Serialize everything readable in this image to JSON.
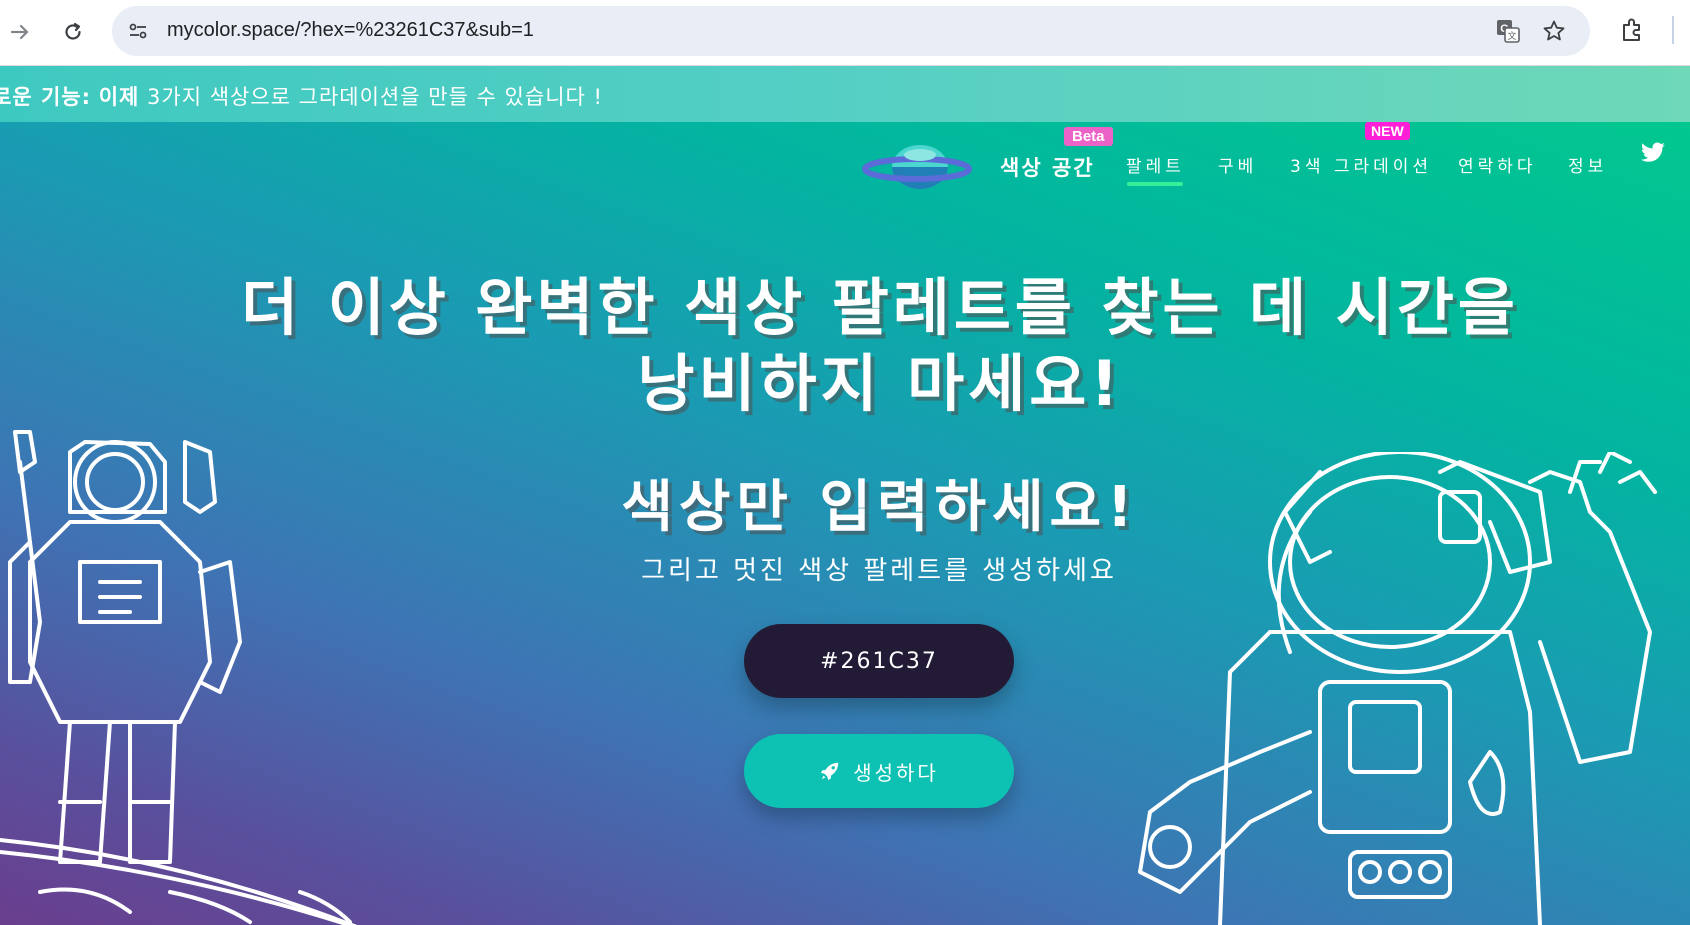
{
  "browser": {
    "url": "mycolor.space/?hex=%23261C37&sub=1",
    "icons": [
      "forward-arrow-icon",
      "reload-icon",
      "site-info-icon",
      "translate-icon",
      "star-icon",
      "extensions-icon"
    ]
  },
  "announcement": {
    "label": "로운 기능:",
    "highlight": "이제",
    "text": "3가지 색상으로 그라데이션을 만들 수 있습니다 !"
  },
  "nav": {
    "brand": "색상 공간",
    "beta_badge": "Beta",
    "links": {
      "palette": "팔레트",
      "buy": "구베",
      "gradient": "3색 그라데이션",
      "contact": "연락하다",
      "about": "정보"
    },
    "new_badge": "NEW",
    "active_color": "#34ef96"
  },
  "hero": {
    "headline_line1": "더 이상 완벽한 색상 팔레트를 찾는 데 시간을",
    "headline_line2": "낭비하지 마세요!",
    "subhead": "색상만 입력하세요!",
    "tagline": "그리고 멋진 색상 팔레트를 생성하세요",
    "input_value": "#261C37",
    "generate_label": "생성하다",
    "colors": {
      "input_bg": "#231b36",
      "button_bg": "#0ec2b3",
      "gradient_top": "#02c78f",
      "gradient_bottom": "#6a3e8e"
    }
  }
}
